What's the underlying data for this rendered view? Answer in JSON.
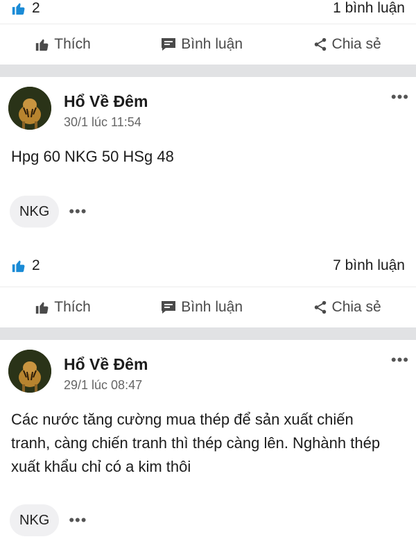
{
  "prev_post": {
    "like_count": "2",
    "comment_count": "1 bình luận",
    "actions": {
      "like": "Thích",
      "comment": "Bình luận",
      "share": "Chia sẻ"
    }
  },
  "post1": {
    "author": "Hổ Về Đêm",
    "time": "30/1 lúc 11:54",
    "content": "Hpg 60 NKG 50 HSg 48",
    "tag": "NKG",
    "like_count": "2",
    "comment_count": "7 bình luận",
    "actions": {
      "like": "Thích",
      "comment": "Bình luận",
      "share": "Chia sẻ"
    }
  },
  "post2": {
    "author": "Hổ Về Đêm",
    "time": "29/1 lúc 08:47",
    "content": "Các nước tăng cường mua thép để sản xuất chiến tranh, càng chiến tranh thì thép càng lên. Nghành thép xuất khẩu chỉ có a kim thôi",
    "tag": "NKG"
  },
  "icons": {
    "like": "thumbs-up-icon",
    "comment": "comment-bubble-icon",
    "share": "share-icon",
    "more": "more-horizontal-icon"
  },
  "colors": {
    "like_blue": "#1a8bd6",
    "separator": "#e1e2e4"
  }
}
